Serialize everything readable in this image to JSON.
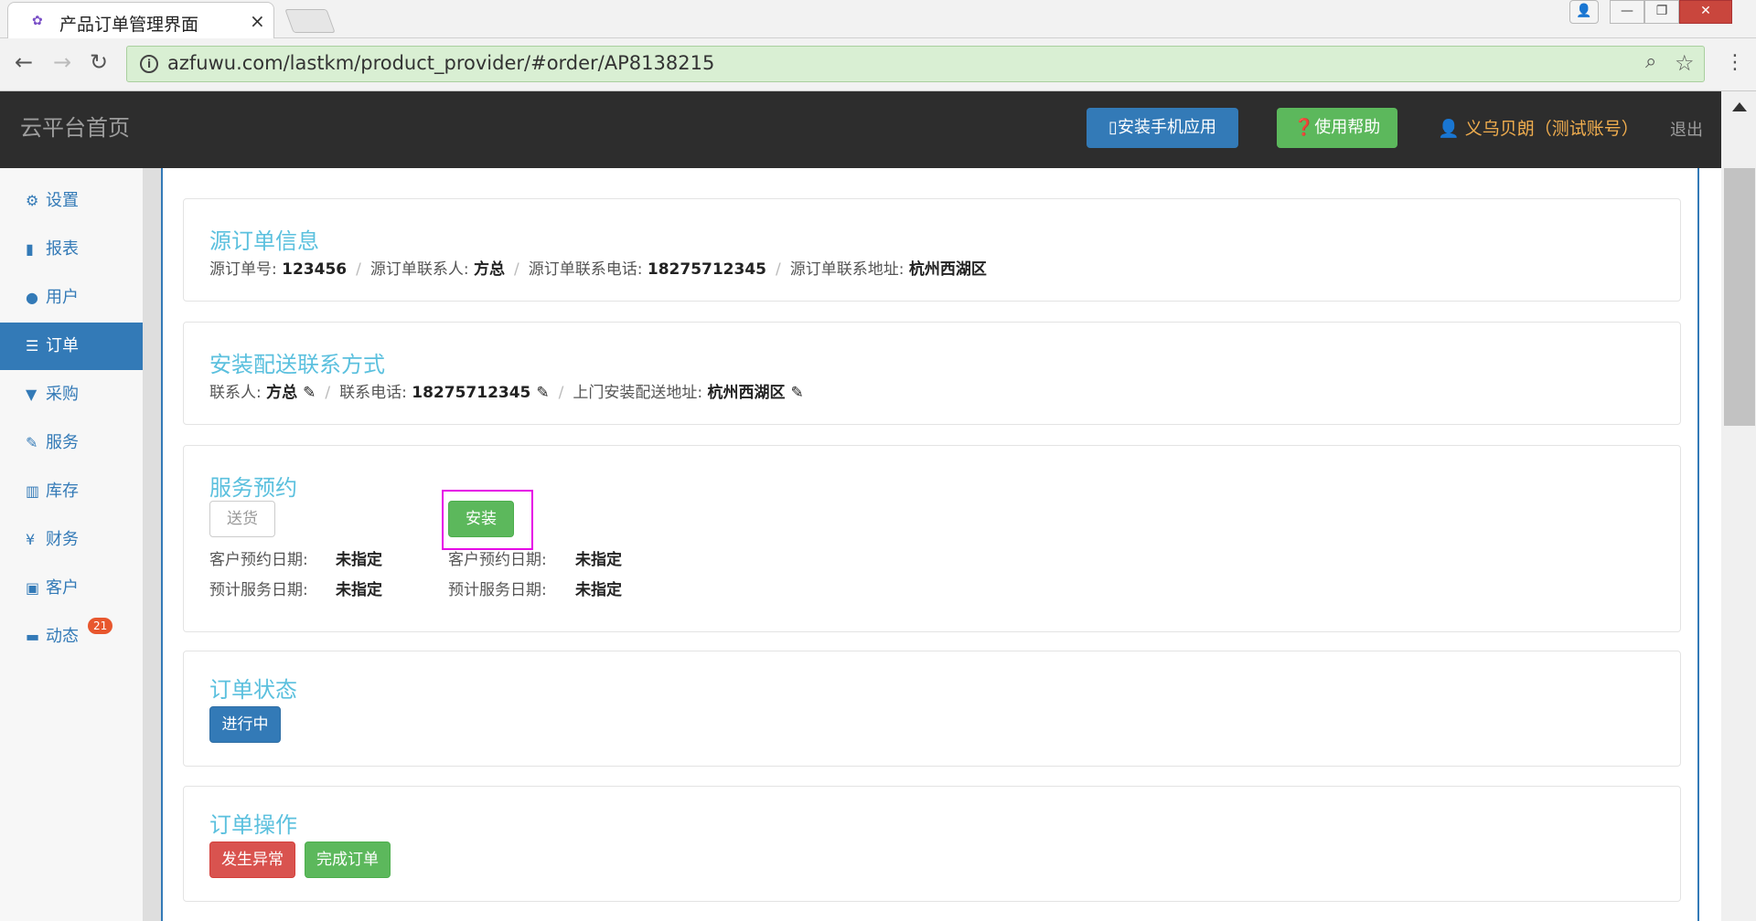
{
  "browser": {
    "tab_title": "产品订单管理界面",
    "tab_close": "×",
    "url": "azfuwu.com/lastkm/product_provider/#order/AP8138215"
  },
  "header": {
    "brand": "云平台首页",
    "install_app": "安装手机应用",
    "help": "使用帮助",
    "user": "义乌贝朗（测试账号）",
    "logout": "退出"
  },
  "sidebar": {
    "items": [
      {
        "label": "设置",
        "icon": "gear-icon"
      },
      {
        "label": "报表",
        "icon": "bar-chart-icon"
      },
      {
        "label": "用户",
        "icon": "user-icon"
      },
      {
        "label": "订单",
        "icon": "list-icon"
      },
      {
        "label": "采购",
        "icon": "cart-icon"
      },
      {
        "label": "服务",
        "icon": "wrench-icon"
      },
      {
        "label": "库存",
        "icon": "barcode-icon"
      },
      {
        "label": "财务",
        "icon": "yen-icon"
      },
      {
        "label": "客户",
        "icon": "briefcase-icon"
      },
      {
        "label": "动态",
        "icon": "comment-icon"
      }
    ],
    "active": "订单",
    "badge": "21"
  },
  "source_order": {
    "title": "源订单信息",
    "no_label": "源订单号:",
    "no": "123456",
    "contact_label": "源订单联系人:",
    "contact": "方总",
    "phone_label": "源订单联系电话:",
    "phone": "18275712345",
    "address_label": "源订单联系地址:",
    "address": "杭州西湖区"
  },
  "delivery": {
    "title": "安装配送联系方式",
    "contact_label": "联系人:",
    "contact": "方总",
    "phone_label": "联系电话:",
    "phone": "18275712345",
    "address_label": "上门安装配送地址:",
    "address": "杭州西湖区"
  },
  "service": {
    "title": "服务预约",
    "deliver_btn": "送货",
    "install_btn": "安装",
    "col1": {
      "cust_label": "客户预约日期:",
      "cust_value": "未指定",
      "plan_label": "预计服务日期:",
      "plan_value": "未指定"
    },
    "col2": {
      "cust_label": "客户预约日期:",
      "cust_value": "未指定",
      "plan_label": "预计服务日期:",
      "plan_value": "未指定"
    }
  },
  "status": {
    "title": "订单状态",
    "value": "进行中"
  },
  "actions": {
    "title": "订单操作",
    "exception": "发生异常",
    "complete": "完成订单"
  },
  "colors": {
    "primary": "#337ab7",
    "success": "#5cb85c",
    "danger": "#d9534f",
    "info": "#5bc0de",
    "header": "#2d2d2d",
    "highlight": "#e600e6"
  }
}
